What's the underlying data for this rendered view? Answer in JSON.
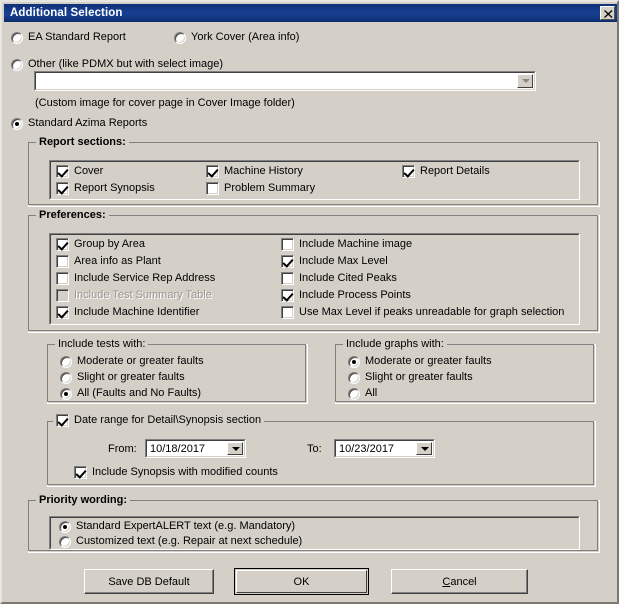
{
  "window": {
    "title": "Additional Selection",
    "close_icon": "close-icon"
  },
  "report_type": {
    "options": [
      {
        "label": "EA Standard Report",
        "selected": false
      },
      {
        "label": "York Cover (Area info)",
        "selected": false
      },
      {
        "label": "Other (like PDMX but with select image)",
        "selected": false
      },
      {
        "label": "Standard Azima Reports",
        "selected": true
      }
    ],
    "custom_image_combo": {
      "value": "",
      "placeholder": ""
    },
    "custom_image_hint": "(Custom image for cover page in Cover Image folder)"
  },
  "report_sections": {
    "title": "Report sections:",
    "items": [
      {
        "label": "Cover",
        "checked": true
      },
      {
        "label": "Machine History",
        "checked": true
      },
      {
        "label": "Report Details",
        "checked": true
      },
      {
        "label": "Report Synopsis",
        "checked": true
      },
      {
        "label": "Problem Summary",
        "checked": false
      }
    ]
  },
  "preferences": {
    "title": "Preferences:",
    "left_column": [
      {
        "label": "Group by Area",
        "checked": true,
        "disabled": false
      },
      {
        "label": "Area info as Plant",
        "checked": false,
        "disabled": false
      },
      {
        "label": "Include Service Rep Address",
        "checked": false,
        "disabled": false
      },
      {
        "label": "Include Test Summary Table",
        "checked": false,
        "disabled": true
      },
      {
        "label": "Include Machine Identifier",
        "checked": true,
        "disabled": false
      }
    ],
    "right_column": [
      {
        "label": "Include Machine image",
        "checked": false,
        "disabled": false
      },
      {
        "label": "Include Max Level",
        "checked": true,
        "disabled": false
      },
      {
        "label": "Include Cited Peaks",
        "checked": false,
        "disabled": false
      },
      {
        "label": "Include Process Points",
        "checked": true,
        "disabled": false
      },
      {
        "label": "Use Max Level if peaks unreadable for graph selection",
        "checked": false,
        "disabled": false
      }
    ]
  },
  "include_tests": {
    "caption": "Include tests with:",
    "options": [
      {
        "label": "Moderate or greater faults",
        "selected": false
      },
      {
        "label": "Slight or greater faults",
        "selected": false
      },
      {
        "label": "All (Faults and No Faults)",
        "selected": true
      }
    ]
  },
  "include_graphs": {
    "caption": "Include graphs with:",
    "options": [
      {
        "label": "Moderate or greater faults",
        "selected": true
      },
      {
        "label": "Slight or greater faults",
        "selected": false
      },
      {
        "label": "All",
        "selected": false
      }
    ]
  },
  "date_range": {
    "caption": "Date range for Detail\\Synopsis section",
    "enabled": true,
    "from_label": "From:",
    "from_value": "10/18/2017",
    "to_label": "To:",
    "to_value": "10/23/2017",
    "include_synopsis": {
      "label": "Include Synopsis with modified counts",
      "checked": true
    }
  },
  "priority_wording": {
    "title": "Priority wording:",
    "options": [
      {
        "label": "Standard ExpertALERT text (e.g. Mandatory)",
        "selected": true
      },
      {
        "label": "Customized text (e.g. Repair at next schedule)",
        "selected": false
      }
    ]
  },
  "buttons": {
    "save_db_default": "Save DB Default",
    "ok": "OK",
    "cancel": "Cancel",
    "cancel_accel": "C",
    "cancel_rest": "ancel"
  }
}
